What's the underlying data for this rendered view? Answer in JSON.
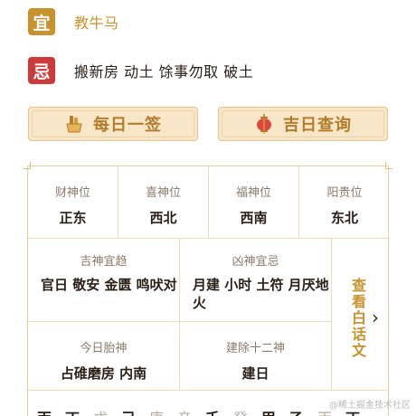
{
  "yi": {
    "badge": "宜",
    "text": "教牛马"
  },
  "ji": {
    "badge": "忌",
    "text": "搬新房  动土  馀事勿取  破土"
  },
  "buttons": {
    "daily": "每日一签",
    "lucky": "吉日查询"
  },
  "gods": [
    {
      "label": "财神位",
      "value": "正东"
    },
    {
      "label": "喜神位",
      "value": "西北"
    },
    {
      "label": "福神位",
      "value": "西南"
    },
    {
      "label": "阳贵位",
      "value": "东北"
    }
  ],
  "details": {
    "good_label": "吉神宜趋",
    "good_value": "官日 敬安 金匮 鸣吠对",
    "bad_label": "凶神宜忌",
    "bad_value": "月建 小时 土符 月厌地火",
    "fetal_label": "今日胎神",
    "fetal_value": "占碓磨房 内南",
    "jianchu_label": "建除十二神",
    "jianchu_value": "建日"
  },
  "side_link": "查看白话文",
  "stems": [
    "丙",
    "丁",
    "戊",
    "己",
    "庚",
    "辛",
    "壬",
    "癸",
    "甲",
    "乙",
    "丙",
    "丁"
  ],
  "watermark": "@稀土掘金技术社区",
  "colors": {
    "gold": "#c8922f",
    "red": "#cc3a3a"
  }
}
